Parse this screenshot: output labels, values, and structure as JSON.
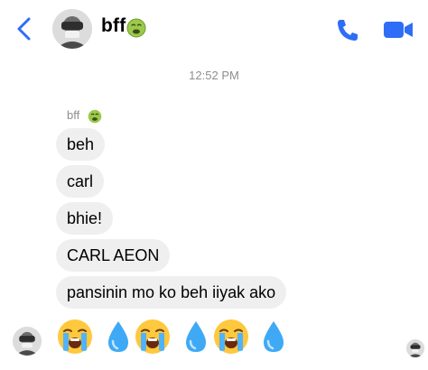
{
  "header": {
    "contact_name": "bff",
    "name_emoji": "nauseated-face",
    "back_icon": "chevron-left-icon",
    "call_icon": "phone-icon",
    "video_icon": "video-camera-icon",
    "accent_color": "#2f6df6"
  },
  "thread": {
    "timestamp": "12:52 PM",
    "sender_name": "bff",
    "sender_emoji": "nauseated-face",
    "messages": [
      {
        "text": "beh"
      },
      {
        "text": "carl"
      },
      {
        "text": "bhie!"
      },
      {
        "text": "CARL AEON"
      },
      {
        "text": "pansinin mo ko beh iiyak ako"
      }
    ],
    "emoji_reply": [
      "loudly-crying-face",
      "droplet",
      "loudly-crying-face",
      "droplet",
      "loudly-crying-face",
      "droplet"
    ]
  },
  "colors": {
    "bubble_bg": "#efefef",
    "meta_text": "#8e8e93"
  }
}
